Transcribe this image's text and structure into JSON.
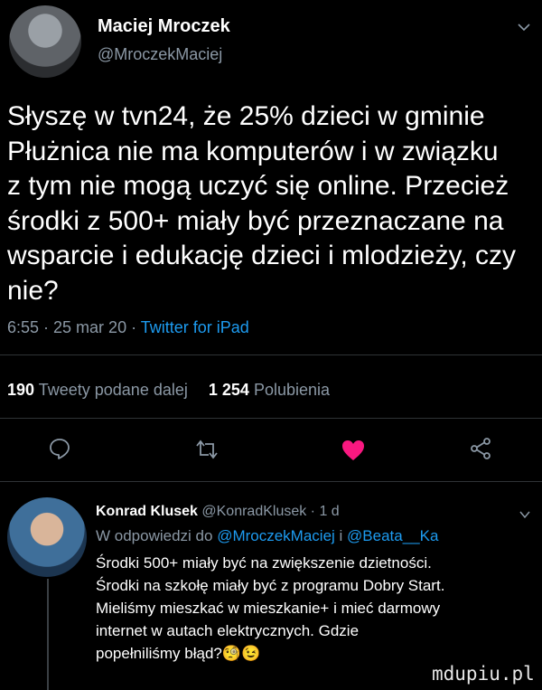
{
  "tweet": {
    "author_name": "Maciej Mroczek",
    "author_handle": "@MroczekMaciej",
    "text_lines": [
      "Słyszę w tvn24, że 25% dzieci w gminie",
      "Płużnica nie ma komputerów i w związku",
      "z tym nie mogą uczyć się online. Przecież",
      "środki z 500+ miały być przeznaczane na",
      "wsparcie i edukację dzieci i mlodzieży, czy",
      "nie?"
    ],
    "time": "6:55 · 25 mar 20 · ",
    "source": "Twitter for iPad",
    "retweets_count": "190",
    "retweets_label": "Tweety podane dalej",
    "likes_count": "1 254",
    "likes_label": "Polubienia"
  },
  "reply": {
    "author_name": "Konrad Klusek",
    "meta": "@KonradKlusek · 1 d",
    "replying_prefix": "W odpowiedzi do ",
    "mention1": "@MroczekMaciej",
    "mention_join": " i ",
    "mention2": "@Beata__Ka",
    "text_lines": [
      "Środki 500+ miały być na zwiększenie dzietności.",
      "Środki na szkołę miały być z programu Dobry Start.",
      "Mieliśmy mieszkać w mieszkanie+ i mieć darmowy",
      "internet w autach elektrycznych. Gdzie",
      "popełniliśmy błąd?"
    ],
    "emojis": "🧐😉"
  },
  "watermark": "mdupiu.pl",
  "colors": {
    "accent": "#1d9bf0",
    "like": "#f91880",
    "muted": "#8b98a5"
  }
}
